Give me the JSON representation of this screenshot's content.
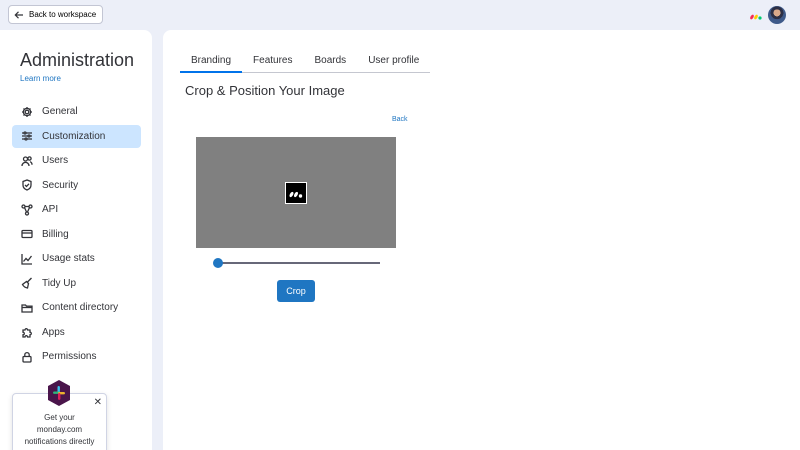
{
  "topbar": {
    "back_label": "Back to workspace"
  },
  "sidebar": {
    "title": "Administration",
    "learn_more": "Learn more",
    "items": [
      {
        "label": "General",
        "icon": "gear-icon"
      },
      {
        "label": "Customization",
        "icon": "sliders-icon",
        "active": true
      },
      {
        "label": "Users",
        "icon": "users-icon"
      },
      {
        "label": "Security",
        "icon": "shield-icon"
      },
      {
        "label": "API",
        "icon": "api-icon"
      },
      {
        "label": "Billing",
        "icon": "credit-card-icon"
      },
      {
        "label": "Usage stats",
        "icon": "chart-line-icon"
      },
      {
        "label": "Tidy Up",
        "icon": "broom-icon"
      },
      {
        "label": "Content directory",
        "icon": "folder-icon"
      },
      {
        "label": "Apps",
        "icon": "puzzle-icon"
      },
      {
        "label": "Permissions",
        "icon": "lock-icon"
      }
    ]
  },
  "promo": {
    "line1": "Get your",
    "line2": "monday.com",
    "line3": "notifications directly"
  },
  "main": {
    "tabs": [
      {
        "label": "Branding",
        "active": true
      },
      {
        "label": "Features"
      },
      {
        "label": "Boards"
      },
      {
        "label": "User profile"
      }
    ],
    "section_title": "Crop & Position Your Image",
    "back_link": "Back",
    "zoom_fraction": 0.0,
    "crop_button": "Crop"
  },
  "colors": {
    "accent": "#1f76c2",
    "active_nav": "#cce5ff",
    "crop_background": "#808080"
  }
}
